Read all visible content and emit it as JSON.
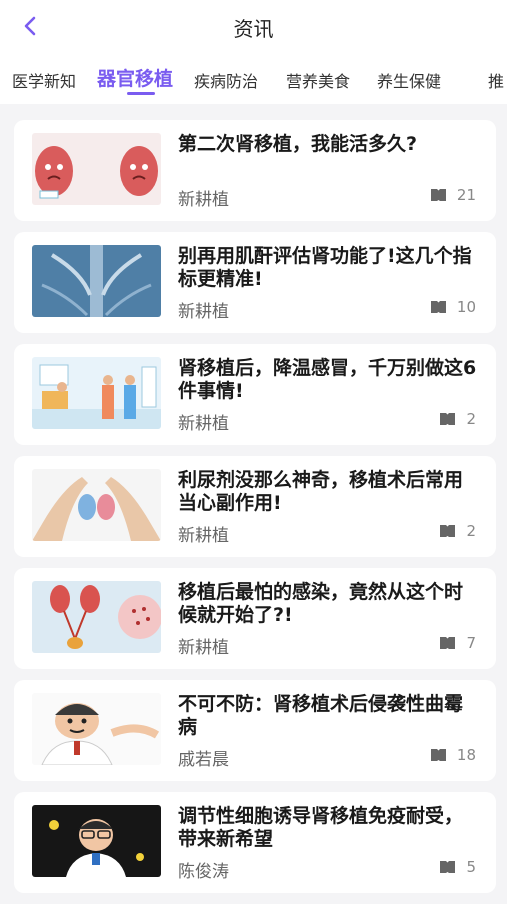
{
  "header": {
    "title": "资讯"
  },
  "tabs": [
    {
      "label": "医学新知"
    },
    {
      "label": "器官移植"
    },
    {
      "label": "疾病防治"
    },
    {
      "label": "营养美食"
    },
    {
      "label": "养生保健"
    },
    {
      "label": "推"
    }
  ],
  "active_tab": "器官移植",
  "articles": [
    {
      "title": "第二次肾移植，我能活多久?",
      "author": "新耕植",
      "count": "21",
      "thumb_icon": "kidney-cartoon-image"
    },
    {
      "title": "别再用肌酐评估肾功能了!这几个指标更精准!",
      "author": "新耕植",
      "count": "10",
      "thumb_icon": "spine-xray-image"
    },
    {
      "title": "肾移植后，降温感冒，千万别做这6件事情!",
      "author": "新耕植",
      "count": "2",
      "thumb_icon": "hospital-scene-image"
    },
    {
      "title": "利尿剂没那么神奇，移植术后常用当心副作用!",
      "author": "新耕植",
      "count": "2",
      "thumb_icon": "hands-kidney-image"
    },
    {
      "title": "移植后最怕的感染，竟然从这个时候就开始了?!",
      "author": "新耕植",
      "count": "7",
      "thumb_icon": "urinary-system-image"
    },
    {
      "title": "不可不防：肾移植术后侵袭性曲霉病",
      "author": "戚若晨",
      "count": "18",
      "thumb_icon": "doctor-cartoon-image"
    },
    {
      "title": "调节性细胞诱导肾移植免疫耐受，带来新希望",
      "author": "陈俊涛",
      "count": "5",
      "thumb_icon": "doctor-cartoon-dark-image"
    }
  ],
  "colors": {
    "accent": "#7a5cf0",
    "background": "#f4f4f6",
    "card": "#ffffff"
  }
}
